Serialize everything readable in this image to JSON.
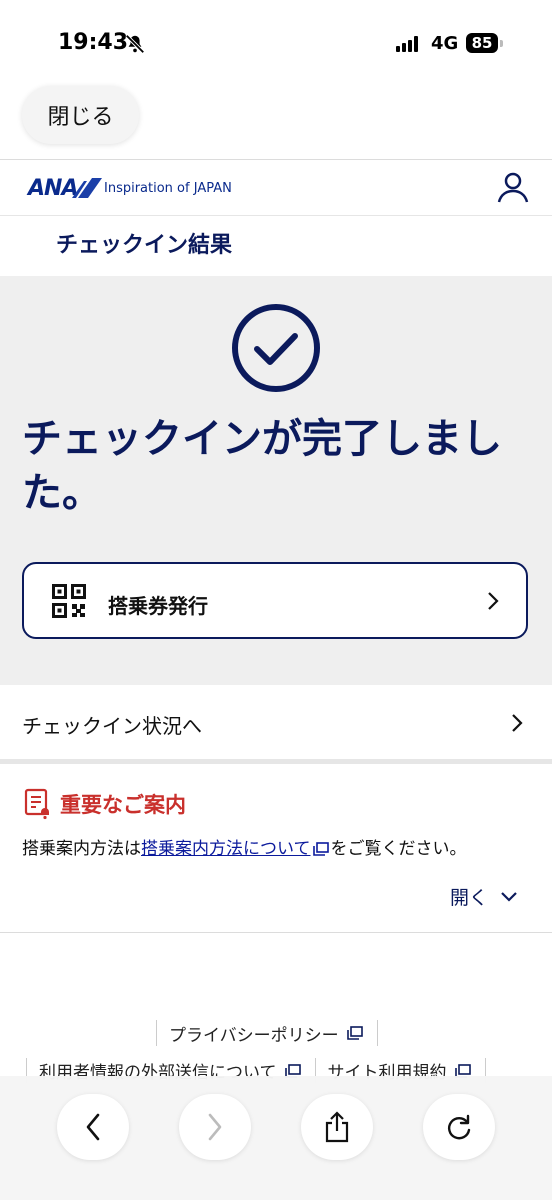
{
  "status_bar": {
    "time": "19:43",
    "network": "4G",
    "battery": "85"
  },
  "browser": {
    "close_label": "閉じる"
  },
  "header": {
    "logo_text": "ANA",
    "tagline": "Inspiration of JAPAN"
  },
  "page": {
    "title": "チェックイン結果"
  },
  "result": {
    "message": "チェックインが完了しました。"
  },
  "boarding_pass": {
    "label": "搭乗券発行"
  },
  "checkin_status": {
    "label": "チェックイン状況へ"
  },
  "notice": {
    "title": "重要なご案内",
    "body_prefix": "搭乗案内方法は",
    "body_link": "搭乗案内方法について",
    "body_suffix": "をご覧ください。",
    "open_label": "開く"
  },
  "footer": {
    "privacy": "プライバシーポリシー",
    "external_transmission": "利用者情報の外部送信について",
    "site_terms": "サイト利用規約"
  },
  "colors": {
    "navy": "#0b1a5c",
    "notice_red": "#c9302c",
    "link_blue": "#0b1a9c"
  }
}
